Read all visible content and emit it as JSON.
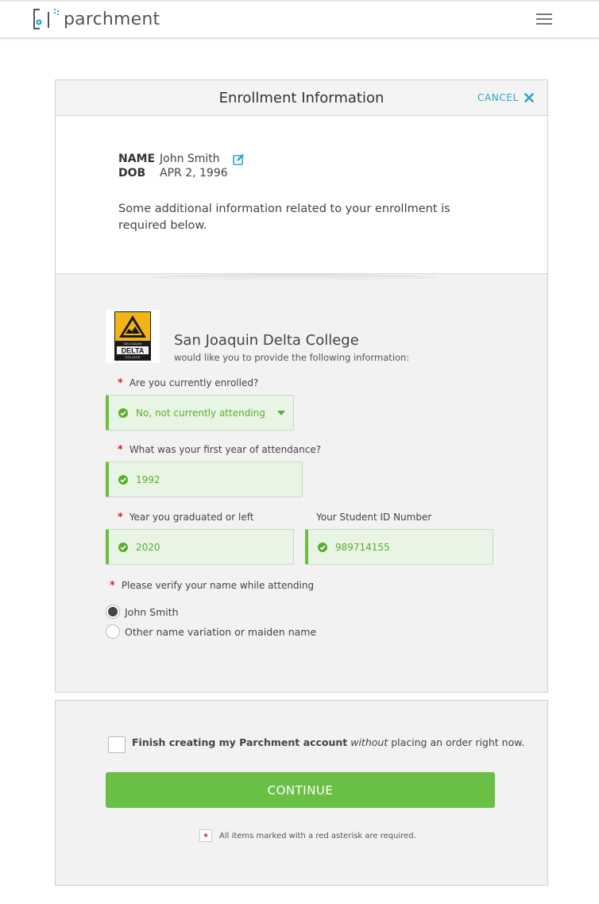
{
  "app": {
    "logo_text": "parchment"
  },
  "header": {
    "title": "Enrollment Information",
    "cancel_label": "CANCEL"
  },
  "student": {
    "name_label": "NAME",
    "name": "John Smith",
    "dob_label": "DOB",
    "dob": "APR 2, 1996",
    "note": "Some additional information related to your enrollment is required below."
  },
  "college": {
    "logo_text_top": "SAN JOAQUIN",
    "logo_text_main": "DELTA",
    "logo_text_bottom": "COLLEGE",
    "name": "San Joaquin Delta College",
    "subtitle": "would like you to provide the following information:"
  },
  "form": {
    "enrolled": {
      "label": "Are you currently enrolled?",
      "value": "No, not currently attending"
    },
    "first_year": {
      "label": "What was your first year of attendance?",
      "value": "1992"
    },
    "grad_year": {
      "label": "Year you graduated or left",
      "value": "2020"
    },
    "student_id": {
      "label": "Your Student ID Number",
      "value": "989714155"
    },
    "verify_name": {
      "label": "Please verify your name while attending",
      "options": [
        {
          "label": "John Smith",
          "selected": true
        },
        {
          "label": "Other name variation or maiden name",
          "selected": false
        }
      ]
    }
  },
  "footer": {
    "finish_bold": "Finish creating my Parchment account",
    "finish_italic": "without",
    "finish_rest": "placing an order right now.",
    "continue_label": "CONTINUE",
    "required_note": "All items marked with a red asterisk are required.",
    "asterisk": "*"
  },
  "colors": {
    "accent_blue": "#2aa6c7",
    "success_green": "#6abf45",
    "required_red": "#d0232a"
  }
}
